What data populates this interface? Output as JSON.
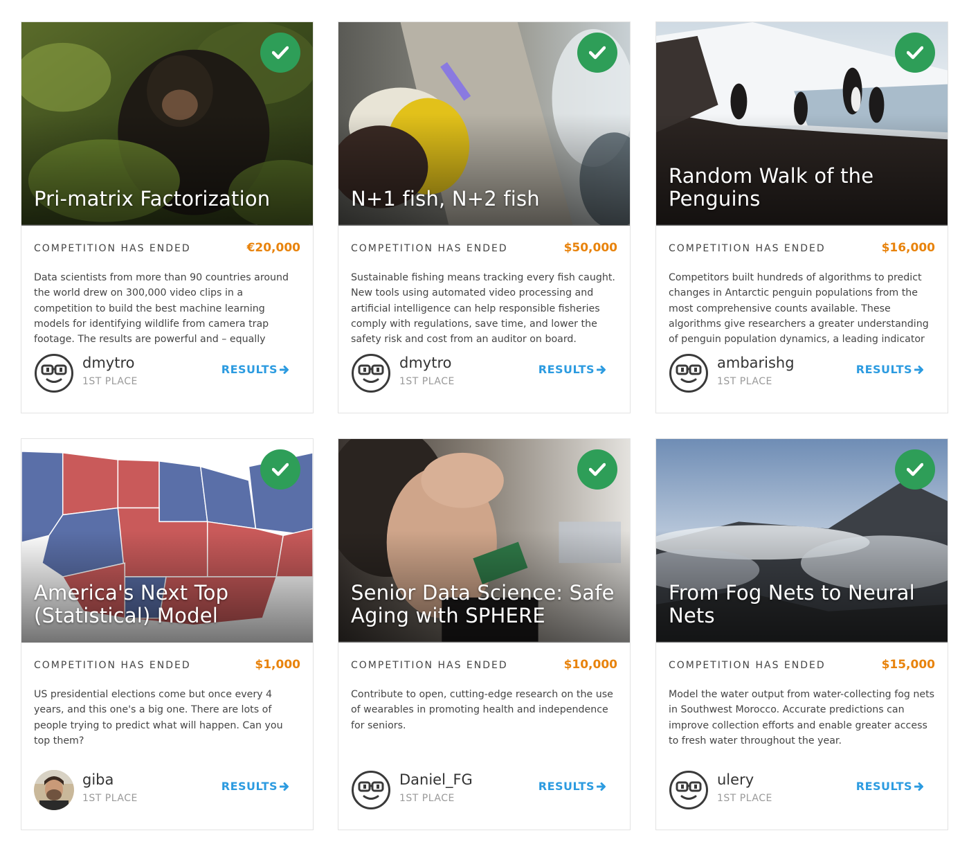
{
  "status_label": "COMPETITION HAS ENDED",
  "results_label": "RESULTS",
  "colors": {
    "accent": "#2c9be0",
    "prize": "#e8830c",
    "check": "#2e9e58"
  },
  "cards": [
    {
      "title": "Pri-matrix Factorization",
      "prize": "€20,000",
      "description": "Data scientists from more than 90 countries around the world drew on 300,000 video clips in a competition to build the best machine learning models for identifying wildlife from camera trap footage. The results are powerful and – equally important ...",
      "user": "dmytro",
      "place": "1ST PLACE",
      "avatar": "robot-avatar-icon"
    },
    {
      "title": "N+1 fish, N+2 fish",
      "prize": "$50,000",
      "description": "Sustainable fishing means tracking every fish caught. New tools using automated video processing and artificial intelligence can help responsible fisheries comply with regulations, save time, and lower the safety risk and cost from an auditor on board.",
      "user": "dmytro",
      "place": "1ST PLACE",
      "avatar": "robot-avatar-icon"
    },
    {
      "title": "Random Walk of the Penguins",
      "prize": "$16,000",
      "description": "Competitors built hundreds of algorithms to predict changes in Antarctic penguin populations from the most comprehensive counts available. These algorithms give researchers a greater understanding of penguin population dynamics, a leading indicator of climate",
      "user": "ambarishg",
      "place": "1ST PLACE",
      "avatar": "robot-avatar-icon"
    },
    {
      "title": "America's Next Top (Statistical) Model",
      "prize": "$1,000",
      "description": "US presidential elections come but once every 4 years, and this one's a big one. There are lots of people trying to predict what will happen. Can you top them?",
      "user": "giba",
      "place": "1ST PLACE",
      "avatar": "photo-avatar"
    },
    {
      "title": "Senior Data Science: Safe Aging with SPHERE",
      "prize": "$10,000",
      "description": "Contribute to open, cutting-edge research on the use of wearables in promoting health and independence for seniors.",
      "user": "Daniel_FG",
      "place": "1ST PLACE",
      "avatar": "robot-avatar-icon"
    },
    {
      "title": "From Fog Nets to Neural Nets",
      "prize": "$15,000",
      "description": "Model the water output from water-collecting fog nets in Southwest Morocco. Accurate predictions can improve collection efforts and enable greater access to fresh water throughout the year.",
      "user": "ulery",
      "place": "1ST PLACE",
      "avatar": "robot-avatar-icon"
    }
  ]
}
